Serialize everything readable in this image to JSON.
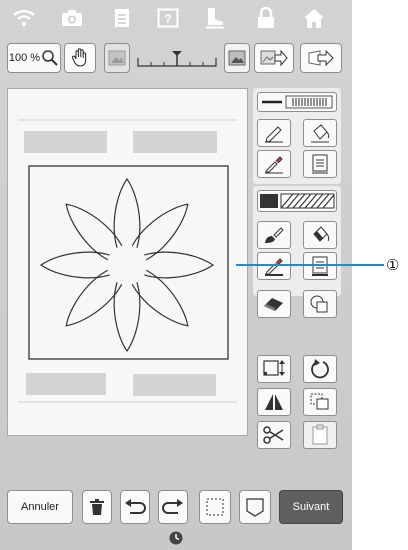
{
  "toolbar": {
    "zoom_value": "100 %"
  },
  "buttons": {
    "cancel_label": "Annuler",
    "next_label": "Suivant"
  },
  "callout": {
    "number": "①"
  },
  "icons": {
    "top": [
      "wifi-icon",
      "camera-icon",
      "document-icon",
      "help-icon",
      "boot-icon",
      "lock-icon",
      "home-icon"
    ],
    "toolbar": [
      "zoom-icon",
      "hand-icon",
      "image-icon",
      "scale-ruler",
      "image-icon",
      "import-icon",
      "export-icon"
    ],
    "panel": [
      "line-type-icon",
      "pen-icon",
      "fill-bucket-icon",
      "eyedropper-icon",
      "list-icon",
      "stitch-pattern-icon",
      "brush-icon",
      "paint-bucket-icon",
      "eyedropper-icon",
      "list-icon",
      "eraser-icon",
      "shape-stamp-icon",
      "resize-icon",
      "rotate-icon",
      "flip-icon",
      "duplicate-icon",
      "scissors-icon",
      "paste-icon"
    ],
    "bottom": [
      "trash-icon",
      "undo-icon",
      "redo-icon",
      "select-icon",
      "background-icon",
      "clock-icon"
    ]
  },
  "colors": {
    "screen_bg": "#cfcfcf",
    "next_button": "#5f5f5f",
    "canvas": "#f7f7f7"
  }
}
